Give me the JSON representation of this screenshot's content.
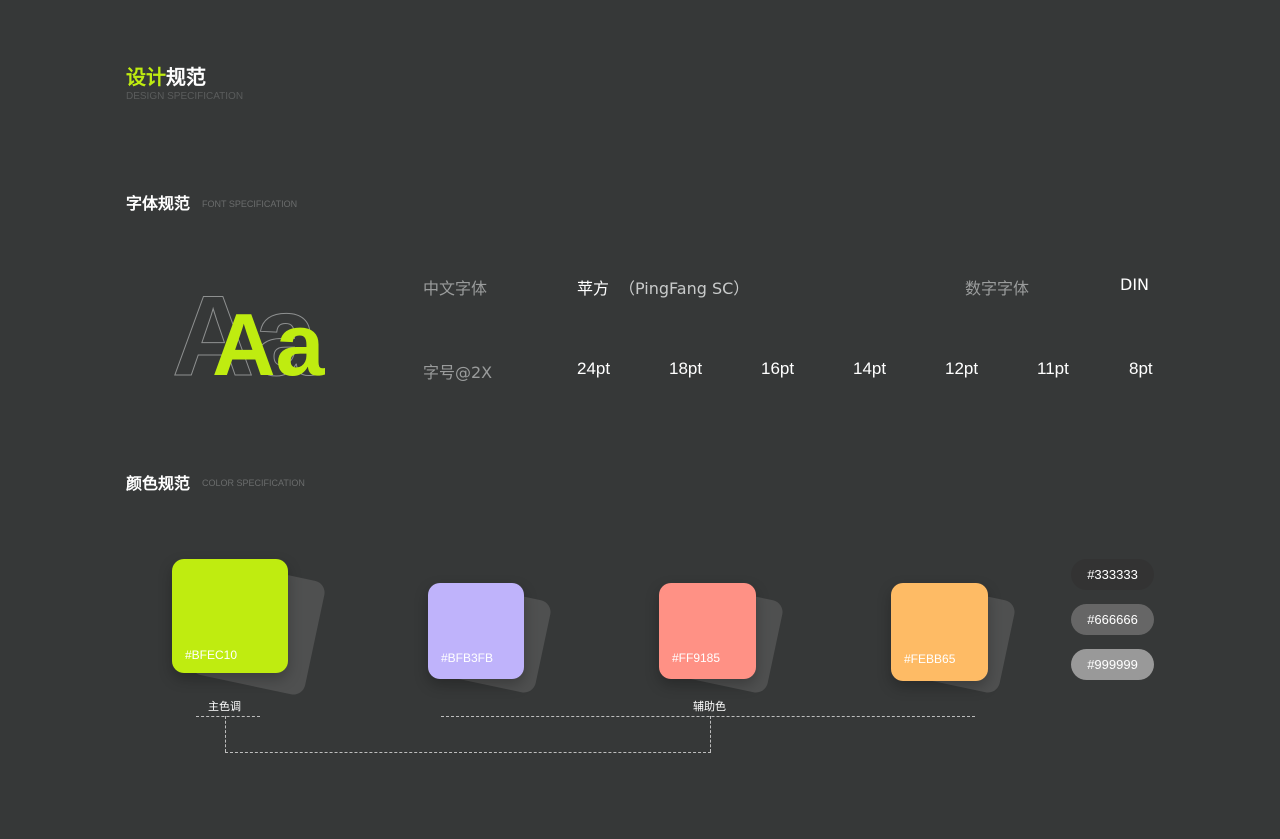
{
  "header": {
    "title_accent": "设计",
    "title_rest": "规范",
    "subtitle": "DESIGN SPECIFICATION"
  },
  "font_section": {
    "title": "字体规范",
    "subtitle": "FONT SPECIFICATION",
    "sample": "Aa",
    "chinese_font_label": "中文字体",
    "chinese_font_name": "苹方",
    "chinese_font_detail": "（PingFang SC）",
    "number_font_label": "数字字体",
    "number_font_name": "DIN",
    "size_label": "字号@2X",
    "sizes": [
      "24pt",
      "18pt",
      "16pt",
      "14pt",
      "12pt",
      "11pt",
      "8pt"
    ]
  },
  "color_section": {
    "title": "颜色规范",
    "subtitle": "COLOR SPECIFICATION",
    "swatches": [
      {
        "hex": "#BFEC10",
        "color": "#BFEC10"
      },
      {
        "hex": "#BFB3FB",
        "color": "#BFB3FB"
      },
      {
        "hex": "#FF9185",
        "color": "#FF9185"
      },
      {
        "hex": "#FEBB65",
        "color": "#FEBB65"
      }
    ],
    "grays": [
      {
        "hex": "#333333",
        "color": "#333333"
      },
      {
        "hex": "#666666",
        "color": "#666666"
      },
      {
        "hex": "#999999",
        "color": "#999999"
      }
    ],
    "primary_caption": "主色调",
    "secondary_caption": "辅助色"
  }
}
